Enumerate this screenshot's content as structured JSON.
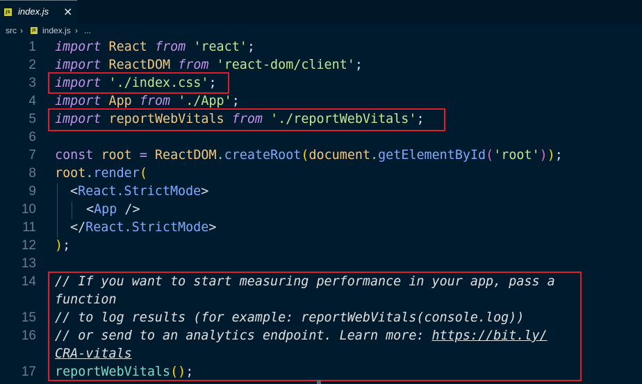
{
  "tab": {
    "badge": "JS",
    "filename": "index.js",
    "close": "×"
  },
  "breadcrumb": {
    "folder": "src",
    "sep": "›",
    "badge": "JS",
    "file": "index.js",
    "more": "..."
  },
  "lines": [
    {
      "n": "1"
    },
    {
      "n": "2"
    },
    {
      "n": "3"
    },
    {
      "n": "4"
    },
    {
      "n": "5"
    },
    {
      "n": "6"
    },
    {
      "n": "7"
    },
    {
      "n": "8"
    },
    {
      "n": "9"
    },
    {
      "n": "10"
    },
    {
      "n": "11"
    },
    {
      "n": "12"
    },
    {
      "n": "13"
    },
    {
      "n": "14"
    },
    {
      "n": "15"
    },
    {
      "n": "16"
    },
    {
      "n": "17"
    }
  ],
  "code": {
    "l1": {
      "kw": "import",
      "id": "React",
      "from": "from",
      "str": "'react'",
      "semi": ";"
    },
    "l2": {
      "kw": "import",
      "id": "ReactDOM",
      "from": "from",
      "str": "'react-dom/client'",
      "semi": ";"
    },
    "l3": {
      "kw": "import",
      "str": "'./index.css'",
      "semi": ";"
    },
    "l4": {
      "kw": "import",
      "id": "App",
      "from": "from",
      "str": "'./App'",
      "semi": ";"
    },
    "l5": {
      "kw": "import",
      "id": "reportWebVitals",
      "from": "from",
      "str": "'./reportWebVitals'",
      "semi": ";"
    },
    "l7": {
      "kw": "const",
      "id": "root",
      "eq": "=",
      "obj": "ReactDOM",
      "dot": ".",
      "fn": "createRoot",
      "p1": "(",
      "doc": "document",
      "dot2": ".",
      "fn2": "getElementById",
      "p2": "(",
      "str": "'root'",
      "p3": ")",
      "p4": ")",
      "semi": ";"
    },
    "l8": {
      "id": "root",
      "dot": ".",
      "fn": "render",
      "p": "("
    },
    "l9": {
      "lt": "<",
      "comp": "React.StrictMode",
      "gt": ">"
    },
    "l10": {
      "lt": "<",
      "comp": "App",
      "end": " />"
    },
    "l11": {
      "lt": "</",
      "comp": "React.StrictMode",
      "gt": ">"
    },
    "l12": {
      "p": ")",
      "semi": ";"
    },
    "l14a": "// If you want to start measuring performance in your app, pass a",
    "l14b": "function",
    "l15": "// to log results (for example: reportWebVitals(console.log))",
    "l16a": "// or send to an analytics endpoint. Learn more: ",
    "l16link": "https://bit.ly/",
    "l17link": "CRA-vitals",
    "l17": {
      "fn": "reportWebVitals",
      "p": "()",
      "semi": ";"
    }
  },
  "colors": {
    "highlight_box": "#e01e2a",
    "background": "#001b2e"
  }
}
